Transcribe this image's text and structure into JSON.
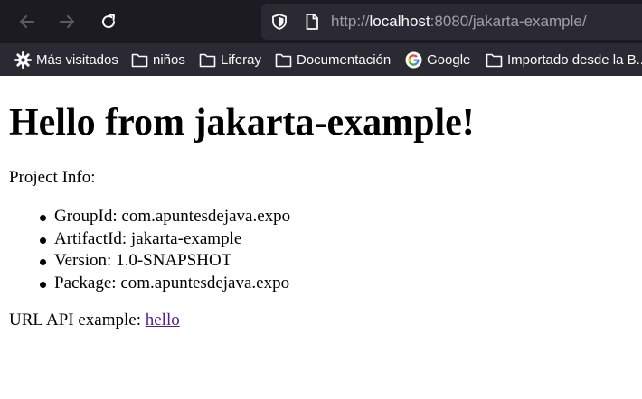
{
  "browser": {
    "url_prefix": "http://",
    "url_host": "localhost",
    "url_rest": ":8080/jakarta-example/"
  },
  "bookmarks": [
    {
      "label": "Más visitados",
      "icon": "gear-icon"
    },
    {
      "label": "niños",
      "icon": "folder-icon"
    },
    {
      "label": "Liferay",
      "icon": "folder-icon"
    },
    {
      "label": "Documentación",
      "icon": "folder-icon"
    },
    {
      "label": "Google",
      "icon": "google-icon"
    },
    {
      "label": "Importado desde la B...",
      "icon": "folder-icon"
    }
  ],
  "page": {
    "heading": "Hello from jakarta-example!",
    "info_label": "Project Info:",
    "items": [
      "GroupId: com.apuntesdejava.expo",
      "ArtifactId: jakarta-example",
      "Version: 1.0-SNAPSHOT",
      "Package: com.apuntesdejava.expo"
    ],
    "api_label": "URL API example: ",
    "api_link": "hello"
  },
  "colors": {
    "toolbar_bg": "#1c1b22",
    "bar_bg": "#2b2a33",
    "visited_link": "#551a8b"
  }
}
